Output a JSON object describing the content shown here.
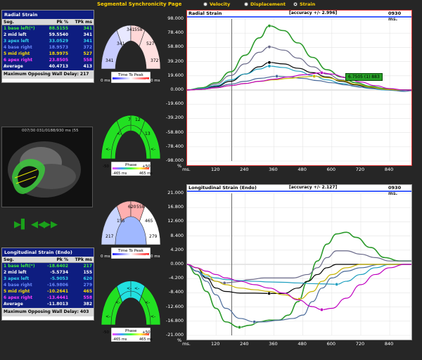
{
  "page_title": "Segmental Synchronicity Page",
  "modes": [
    {
      "label": "Velocity",
      "selected": false
    },
    {
      "label": "Displacement",
      "selected": false
    },
    {
      "label": "Strain",
      "selected": true
    }
  ],
  "radial_table": {
    "title": "Radial Strain",
    "headers": [
      "Seg.",
      "Pk %",
      "TPk ms"
    ],
    "rows": [
      {
        "seg": "1 base left(*)",
        "pk": "88.5155",
        "tpk": "341",
        "color": "#3cf03c"
      },
      {
        "seg": "2 mid left",
        "pk": "59.5540",
        "tpk": "341",
        "color": "#ffffff"
      },
      {
        "seg": "3 apex left",
        "pk": "33.0529",
        "tpk": "341",
        "color": "#34d6f0"
      },
      {
        "seg": "4 base right",
        "pk": "18.9573",
        "tpk": "372",
        "color": "#6c8cff"
      },
      {
        "seg": "5 mid right",
        "pk": "18.9975",
        "tpk": "527",
        "color": "#ffe000"
      },
      {
        "seg": "6 apex right",
        "pk": "23.8505",
        "tpk": "558",
        "color": "#ff3cff"
      }
    ],
    "average": {
      "label": "Average",
      "pk": "40.4713",
      "tpk": "413"
    },
    "delay": "Maximum Opposing Wall Delay: 217"
  },
  "long_table": {
    "title": "Longitudinal Strain (Endo)",
    "headers": [
      "Seg.",
      "Pk %",
      "TPk ms"
    ],
    "rows": [
      {
        "seg": "1 base left(*)",
        "pk": "-18.6402",
        "tpk": "217",
        "color": "#3cf03c"
      },
      {
        "seg": "2 mid left",
        "pk": "-5.5734",
        "tpk": "155",
        "color": "#ffffff"
      },
      {
        "seg": "3 apex left",
        "pk": "-5.9053",
        "tpk": "620",
        "color": "#34d6f0"
      },
      {
        "seg": "4 base right",
        "pk": "-16.9806",
        "tpk": "279",
        "color": "#6c8cff"
      },
      {
        "seg": "5 mid right",
        "pk": "-10.2641",
        "tpk": "465",
        "color": "#ffe000"
      },
      {
        "seg": "6 apex right",
        "pk": "-13.4441",
        "tpk": "558",
        "color": "#ff3cff"
      }
    ],
    "average": {
      "label": "Average",
      "pk": "-11.8013",
      "tpk": "382"
    },
    "delay": "Maximum Opposing Wall Delay: 403"
  },
  "image_label": "007/30 031/0188/930 ms (55 ",
  "wheel_top": {
    "values": [
      "341",
      "558",
      "527",
      "341",
      "341",
      "372"
    ],
    "legend_title": "Time To Peak",
    "legend_min": "0 ms",
    "legend_max": "930 ms"
  },
  "wheel_top_phase": {
    "values": [
      "7",
      "12",
      "13",
      "<-",
      "<-",
      "<-"
    ],
    "legend_title": "Phase",
    "legend_min": "-50",
    "legend_max": "+50",
    "legend_range_min": "-465 ms",
    "legend_range_max": "465 ms"
  },
  "wheel_bottom": {
    "values": [
      "620",
      "558",
      "465",
      "279",
      "217",
      "155"
    ],
    "legend_title": "Time To Peak",
    "legend_min": "0 ms",
    "legend_max": "930 ms"
  },
  "wheel_bottom_phase": {
    "values": [
      "<-",
      "<-",
      "<-",
      "<-",
      "<-",
      "<-"
    ],
    "legend_title": "Phase",
    "legend_min": "-50",
    "legend_max": "+50",
    "legend_range_min": "-465 ms",
    "legend_range_max": "465 ms"
  },
  "radial_chart": {
    "title": "Radial Strain",
    "accuracy": "[accuracy +/- 2.996]",
    "time": "0930 ms.",
    "tooltip": "6.7505 (1) 883",
    "y_unit": "%",
    "x_unit": "ms."
  },
  "long_chart": {
    "title": "Longitudinal Strain (Endo)",
    "accuracy": "[accuracy +/- 2.127]",
    "time": "0930 ms.",
    "y_unit": "%",
    "x_unit": "ms."
  },
  "chart_data": [
    {
      "type": "line",
      "title": "Radial Strain",
      "xlabel": "ms.",
      "ylabel": "%",
      "xlim": [
        0,
        930
      ],
      "ylim": [
        -98,
        98
      ],
      "y_ticks": [
        "98.000",
        "78.400",
        "58.800",
        "39.200",
        "19.600",
        "0.000",
        "-19.600",
        "-39.200",
        "-58.800",
        "-78.400",
        "-98.000"
      ],
      "x_ticks": [
        "ms.",
        "120",
        "240",
        "360",
        "480",
        "600",
        "720",
        "840"
      ],
      "cursor_x": 185,
      "series": [
        {
          "color": "#2a9a2a",
          "x": [
            0,
            60,
            120,
            180,
            240,
            300,
            341,
            400,
            460,
            520,
            580,
            640,
            700,
            760,
            820,
            880,
            930
          ],
          "y": [
            0,
            3,
            10,
            25,
            48,
            72,
            88.5,
            82,
            65,
            45,
            28,
            18,
            10,
            5,
            2,
            0,
            0
          ]
        },
        {
          "color": "#6a6a8a",
          "x": [
            0,
            60,
            120,
            180,
            240,
            300,
            341,
            400,
            460,
            520,
            580,
            640,
            700,
            760,
            820,
            880,
            930
          ],
          "y": [
            0,
            2,
            8,
            20,
            36,
            52,
            59.5,
            55,
            44,
            32,
            22,
            14,
            8,
            4,
            1,
            0,
            0
          ]
        },
        {
          "color": "#000000",
          "x": [
            0,
            60,
            120,
            180,
            240,
            300,
            341,
            400,
            460,
            520,
            580,
            640,
            700,
            760,
            820,
            880,
            930
          ],
          "y": [
            0,
            1,
            5,
            12,
            22,
            32,
            38,
            36,
            30,
            24,
            18,
            12,
            7,
            3,
            1,
            0,
            0
          ]
        },
        {
          "color": "#20a0c0",
          "x": [
            0,
            60,
            120,
            180,
            240,
            300,
            341,
            400,
            460,
            520,
            580,
            640,
            700,
            760,
            820,
            880,
            930
          ],
          "y": [
            0,
            2,
            6,
            14,
            22,
            29,
            33,
            31,
            26,
            20,
            14,
            9,
            5,
            2,
            0,
            -1,
            0
          ]
        },
        {
          "color": "#4a6a9a",
          "x": [
            0,
            60,
            120,
            180,
            240,
            300,
            372,
            420,
            480,
            540,
            600,
            660,
            720,
            780,
            840,
            900,
            930
          ],
          "y": [
            0,
            1,
            4,
            8,
            12,
            16,
            19,
            18,
            16,
            13,
            10,
            7,
            4,
            2,
            0,
            -2,
            -1
          ]
        },
        {
          "color": "#c8b400",
          "x": [
            0,
            60,
            120,
            180,
            240,
            300,
            360,
            420,
            480,
            527,
            580,
            640,
            700,
            760,
            820,
            880,
            930
          ],
          "y": [
            0,
            1,
            3,
            6,
            9,
            12,
            14,
            16,
            18,
            19,
            17,
            13,
            8,
            4,
            1,
            0,
            0
          ]
        },
        {
          "color": "#c000c0",
          "x": [
            0,
            60,
            120,
            180,
            240,
            300,
            360,
            420,
            480,
            558,
            600,
            660,
            720,
            780,
            840,
            900,
            930
          ],
          "y": [
            0,
            1,
            3,
            6,
            9,
            12,
            15,
            18,
            21,
            23.8,
            22,
            17,
            11,
            6,
            2,
            0,
            0
          ]
        }
      ]
    },
    {
      "type": "line",
      "title": "Longitudinal Strain (Endo)",
      "xlabel": "ms.",
      "ylabel": "%",
      "xlim": [
        0,
        930
      ],
      "ylim": [
        -21,
        21
      ],
      "y_ticks": [
        "21.000",
        "16.800",
        "12.600",
        "8.400",
        "4.200",
        "0.000",
        "-4.200",
        "-8.400",
        "-12.600",
        "-16.800",
        "-21.000"
      ],
      "x_ticks": [
        "ms.",
        "120",
        "240",
        "360",
        "480",
        "600",
        "720",
        "840"
      ],
      "cursor_x": 185,
      "series": [
        {
          "color": "#2a9a2a",
          "x": [
            0,
            40,
            80,
            120,
            160,
            217,
            260,
            300,
            340,
            380,
            420,
            460,
            500,
            540,
            580,
            620,
            660,
            700,
            760,
            820,
            880,
            930
          ],
          "y": [
            0,
            -3,
            -8,
            -13,
            -17,
            -18.6,
            -18,
            -17,
            -16.5,
            -16.5,
            -15,
            -11,
            -5,
            1,
            6,
            9,
            9.5,
            8,
            5,
            2,
            1,
            1
          ]
        },
        {
          "color": "#6a6a8a",
          "x": [
            0,
            40,
            80,
            120,
            155,
            200,
            260,
            320,
            380,
            440,
            500,
            540,
            580,
            620,
            660,
            720,
            780,
            840,
            900,
            930
          ],
          "y": [
            0,
            -2,
            -4,
            -5,
            -5.5,
            -5.2,
            -4.5,
            -4,
            -4,
            -4,
            -3,
            -1,
            2,
            4,
            4,
            3,
            2,
            1,
            1,
            1
          ]
        },
        {
          "color": "#000000",
          "x": [
            0,
            40,
            80,
            120,
            160,
            220,
            280,
            340,
            400,
            460,
            500,
            540,
            580,
            620,
            680,
            740,
            800,
            860,
            930
          ],
          "y": [
            0,
            -1,
            -4,
            -7,
            -8,
            -8.5,
            -8.5,
            -8.6,
            -8.6,
            -7,
            -5,
            -3,
            -1,
            0,
            0,
            0,
            0,
            0,
            0
          ]
        },
        {
          "color": "#20a0c0",
          "x": [
            0,
            40,
            80,
            120,
            160,
            220,
            280,
            340,
            400,
            460,
            520,
            580,
            620,
            660,
            720,
            780,
            840,
            900,
            930
          ],
          "y": [
            0,
            -2,
            -3.5,
            -4,
            -4.5,
            -4.8,
            -5,
            -5.2,
            -5.3,
            -5.5,
            -5.7,
            -5.8,
            -5.9,
            -5,
            -3,
            -1,
            0,
            0,
            0
          ]
        },
        {
          "color": "#4a6a9a",
          "x": [
            0,
            40,
            80,
            120,
            160,
            220,
            279,
            320,
            380,
            440,
            480,
            520,
            560,
            600,
            660,
            720,
            800,
            880,
            930
          ],
          "y": [
            0,
            -2,
            -5,
            -9,
            -13,
            -16,
            -17,
            -17,
            -16.5,
            -16,
            -15,
            -11,
            -7,
            -4,
            -2,
            -1,
            0,
            0,
            0
          ]
        },
        {
          "color": "#c8b400",
          "x": [
            0,
            40,
            80,
            120,
            160,
            220,
            280,
            340,
            400,
            465,
            520,
            560,
            600,
            660,
            720,
            780,
            840,
            900,
            930
          ],
          "y": [
            0,
            -1,
            -3,
            -5,
            -6,
            -7,
            -7.5,
            -8,
            -9,
            -10.3,
            -8,
            -5,
            -3,
            -1,
            0,
            0,
            0,
            0,
            0
          ]
        },
        {
          "color": "#c000c0",
          "x": [
            0,
            40,
            80,
            120,
            160,
            220,
            280,
            340,
            400,
            460,
            520,
            558,
            600,
            660,
            720,
            780,
            840,
            900,
            930
          ],
          "y": [
            0,
            -1,
            -2,
            -3,
            -4,
            -5,
            -6,
            -7,
            -8.5,
            -10.5,
            -12.5,
            -13.4,
            -13,
            -10,
            -6,
            -3,
            -1,
            0,
            0
          ]
        }
      ]
    }
  ]
}
